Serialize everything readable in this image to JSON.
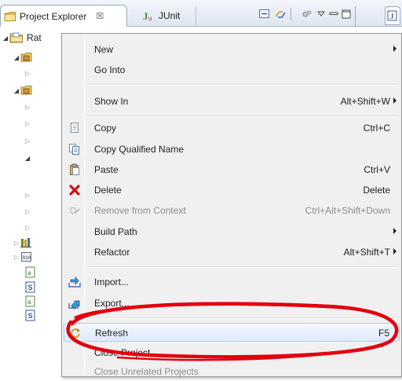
{
  "tabs": {
    "project_explorer": "Project Explorer",
    "project_explorer_close": "☒",
    "junit": "JUnit"
  },
  "tree": {
    "root_label": "Rat"
  },
  "menu": [
    {
      "label": "New",
      "shortcut": "",
      "submenu": true,
      "icon": "",
      "enabled": true
    },
    {
      "label": "Go Into",
      "shortcut": "",
      "submenu": false,
      "icon": "",
      "enabled": true
    },
    {
      "label": "Show In",
      "shortcut": "Alt+Shift+W",
      "submenu": true,
      "icon": "",
      "enabled": true
    },
    {
      "label": "Copy",
      "shortcut": "Ctrl+C",
      "submenu": false,
      "icon": "copy-icon",
      "enabled": true
    },
    {
      "label": "Copy Qualified Name",
      "shortcut": "",
      "submenu": false,
      "icon": "copy-qualified-name-icon",
      "enabled": true
    },
    {
      "label": "Paste",
      "shortcut": "Ctrl+V",
      "submenu": false,
      "icon": "paste-icon",
      "enabled": true
    },
    {
      "label": "Delete",
      "shortcut": "Delete",
      "submenu": false,
      "icon": "delete-icon",
      "enabled": true
    },
    {
      "label": "Remove from Context",
      "shortcut": "Ctrl+Alt+Shift+Down",
      "submenu": false,
      "icon": "remove-from-context-icon",
      "enabled": false
    },
    {
      "label": "Build Path",
      "shortcut": "",
      "submenu": true,
      "icon": "",
      "enabled": true
    },
    {
      "label": "Refactor",
      "shortcut": "Alt+Shift+T",
      "submenu": true,
      "icon": "",
      "enabled": true
    },
    {
      "label": "Import...",
      "shortcut": "",
      "submenu": false,
      "icon": "import-icon",
      "enabled": true
    },
    {
      "label": "Export...",
      "shortcut": "",
      "submenu": false,
      "icon": "export-icon",
      "enabled": true
    },
    {
      "label": "Refresh",
      "shortcut": "F5",
      "submenu": false,
      "icon": "refresh-icon",
      "enabled": true
    },
    {
      "label": "Close Project",
      "shortcut": "",
      "submenu": false,
      "icon": "",
      "enabled": true
    },
    {
      "label": "Close Unrelated Projects",
      "shortcut": "",
      "submenu": false,
      "icon": "",
      "enabled": false
    }
  ],
  "colors": {
    "highlight_border": "#aeccf1",
    "annotation_red": "#e3000f",
    "delete_red": "#d01010",
    "menu_background": "#f0f0f0"
  }
}
